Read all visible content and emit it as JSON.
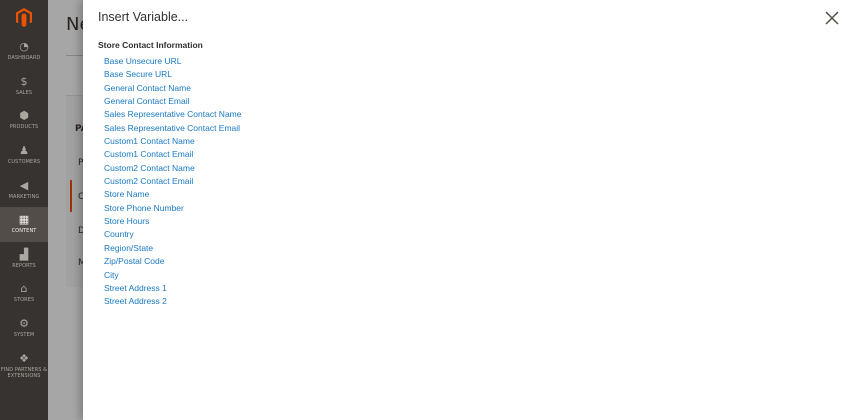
{
  "sidebar": {
    "logo_icon": "magento-logo-icon",
    "items": [
      {
        "label": "DASHBOARD",
        "icon": "dashboard-icon",
        "glyph": "◔"
      },
      {
        "label": "SALES",
        "icon": "dollar-icon",
        "glyph": "$"
      },
      {
        "label": "PRODUCTS",
        "icon": "cube-icon",
        "glyph": "⬢"
      },
      {
        "label": "CUSTOMERS",
        "icon": "person-icon",
        "glyph": "♟"
      },
      {
        "label": "MARKETING",
        "icon": "megaphone-icon",
        "glyph": "◀"
      },
      {
        "label": "CONTENT",
        "icon": "content-icon",
        "glyph": "▦"
      },
      {
        "label": "REPORTS",
        "icon": "bar-chart-icon",
        "glyph": "▟"
      },
      {
        "label": "STORES",
        "icon": "store-icon",
        "glyph": "⌂"
      },
      {
        "label": "SYSTEM",
        "icon": "gear-icon",
        "glyph": "⚙"
      },
      {
        "label": "FIND PARTNERS & EXTENSIONS",
        "icon": "blocks-icon",
        "glyph": "❖"
      }
    ]
  },
  "background": {
    "title": "Ne",
    "letters": [
      "PA",
      "P",
      "C",
      "D",
      "M"
    ]
  },
  "modal": {
    "title": "Insert Variable...",
    "close_icon": "close-icon",
    "section_title": "Store Contact Information",
    "variables": [
      "Base Unsecure URL",
      "Base Secure URL",
      "General Contact Name",
      "General Contact Email",
      "Sales Representative Contact Name",
      "Sales Representative Contact Email",
      "Custom1 Contact Name",
      "Custom1 Contact Email",
      "Custom2 Contact Name",
      "Custom2 Contact Email",
      "Store Name",
      "Store Phone Number",
      "Store Hours",
      "Country",
      "Region/State",
      "Zip/Postal Code",
      "City",
      "Street Address 1",
      "Street Address 2"
    ]
  },
  "colors": {
    "sidebar_bg": "#373330",
    "link": "#1979c3",
    "logo": "#eb5202"
  }
}
